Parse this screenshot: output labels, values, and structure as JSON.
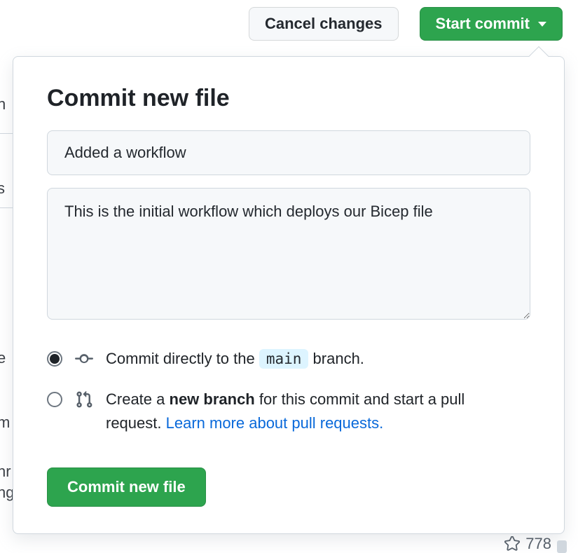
{
  "top": {
    "cancel_label": "Cancel changes",
    "start_commit_label": "Start commit"
  },
  "popover": {
    "title": "Commit new file",
    "summary_value": "Added a workflow",
    "description_value": "This is the initial workflow which deploys our Bicep file",
    "option_direct": {
      "prefix": "Commit directly to the ",
      "branch": "main",
      "suffix": " branch."
    },
    "option_branch": {
      "part1": "Create a ",
      "bold": "new branch",
      "part2": " for this commit and start a pull request. ",
      "link": "Learn more about pull requests."
    },
    "commit_button_label": "Commit new file"
  },
  "stars": {
    "count": "778"
  }
}
